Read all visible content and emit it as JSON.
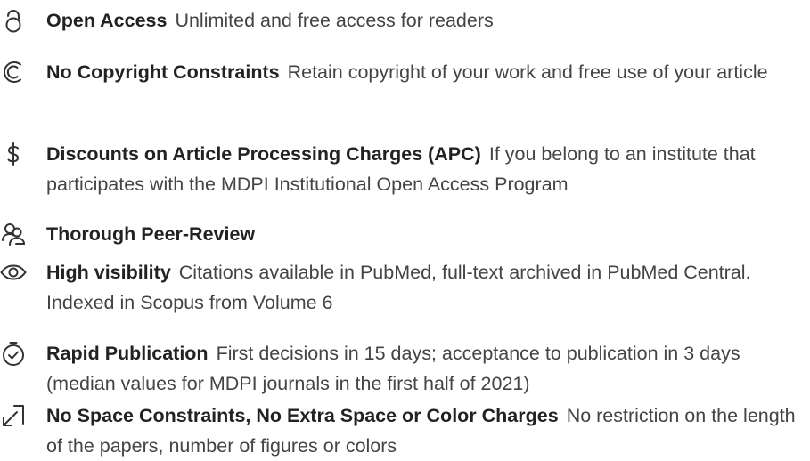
{
  "benefits": [
    {
      "icon": "open-lock-icon",
      "title": "Open Access",
      "description": "Unlimited and free access for readers"
    },
    {
      "icon": "no-copyright-icon",
      "title": "No Copyright Constraints",
      "description": "Retain copyright of your work and free use of your article"
    },
    {
      "icon": "dollar-icon",
      "title": "Discounts on Article Processing Charges (APC)",
      "description": "If you belong to an institute that participates with the MDPI Institutional Open Access Program"
    },
    {
      "icon": "reviewers-icon",
      "title": "Thorough Peer-Review",
      "description": ""
    },
    {
      "icon": "eye-icon",
      "title": "High visibility",
      "description": "Citations available in PubMed, full-text archived in PubMed Central. Indexed in Scopus from Volume 6"
    },
    {
      "icon": "stopwatch-check-icon",
      "title": "Rapid Publication",
      "description": "First decisions in 15 days; acceptance to publication in 3 days (median values for MDPI journals in the first half of 2021)"
    },
    {
      "icon": "expand-arrow-icon",
      "title": "No Space Constraints, No Extra Space or Color Charges",
      "description": "No restriction on the length of the papers, number of figures or colors"
    }
  ],
  "colors": {
    "title": "#222222",
    "text": "#444444",
    "icon": "#333333"
  }
}
